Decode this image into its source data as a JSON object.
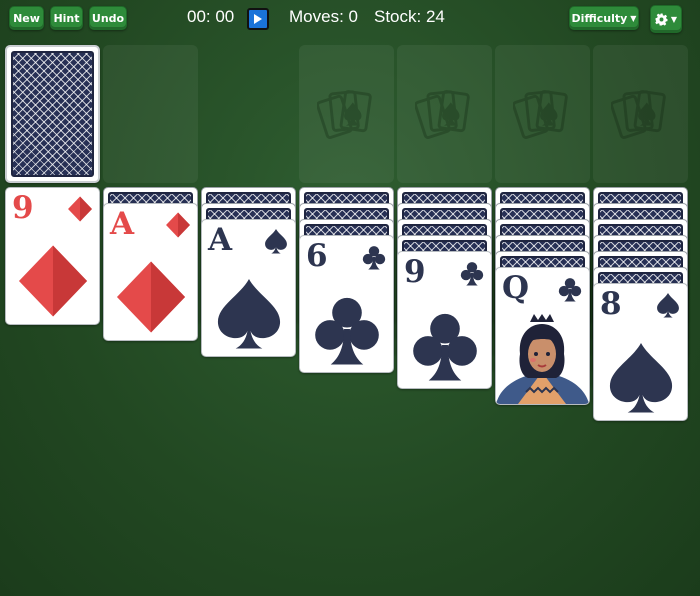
{
  "toolbar": {
    "new_label": "New",
    "hint_label": "Hint",
    "undo_label": "Undo",
    "timer": "00: 00",
    "moves": "Moves: 0",
    "stock": "Stock: 24",
    "difficulty_label": "Difficulty",
    "play_icon": "play-icon",
    "settings_icon": "gear-icon"
  },
  "colors": {
    "felt": "#224822",
    "button": "#2e8b3a",
    "red_suit": "#e44a4a",
    "black_suit": "#2d3550",
    "play_button": "#1a73d9"
  },
  "stock_pile": {
    "face_down": true
  },
  "waste_pile": {
    "empty": true
  },
  "foundations": [
    {
      "empty": true,
      "icon": "cards-icon"
    },
    {
      "empty": true,
      "icon": "cards-icon"
    },
    {
      "empty": true,
      "icon": "cards-icon"
    },
    {
      "empty": true,
      "icon": "cards-icon"
    }
  ],
  "tableau": [
    {
      "face_down": 0,
      "top_card": {
        "rank": "9",
        "suit": "diamonds",
        "color": "red"
      }
    },
    {
      "face_down": 1,
      "top_card": {
        "rank": "A",
        "suit": "diamonds",
        "color": "red"
      }
    },
    {
      "face_down": 2,
      "top_card": {
        "rank": "A",
        "suit": "spades",
        "color": "black"
      }
    },
    {
      "face_down": 3,
      "top_card": {
        "rank": "6",
        "suit": "clubs",
        "color": "black"
      }
    },
    {
      "face_down": 4,
      "top_card": {
        "rank": "9",
        "suit": "clubs",
        "color": "black"
      }
    },
    {
      "face_down": 5,
      "top_card": {
        "rank": "Q",
        "suit": "clubs",
        "color": "black"
      }
    },
    {
      "face_down": 6,
      "top_card": {
        "rank": "8",
        "suit": "spades",
        "color": "black"
      }
    }
  ]
}
